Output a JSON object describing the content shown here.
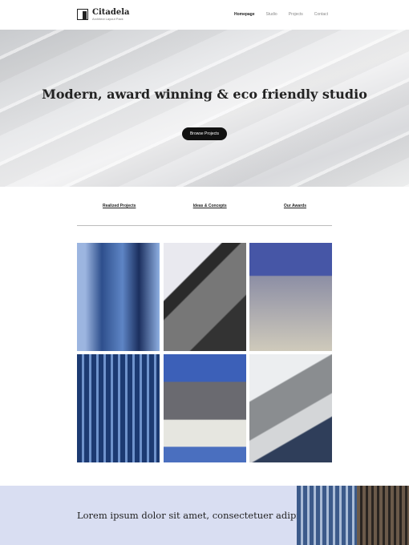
{
  "header": {
    "brand": "Citadela",
    "tagline": "Architect Layout Pack",
    "nav": [
      "Homepage",
      "Studio",
      "Projects",
      "Contact"
    ]
  },
  "hero": {
    "title": "Modern, award winning & eco friendly studio",
    "button": "Browse Projects"
  },
  "tabs": [
    "Realized Projects",
    "Ideas & Concepts",
    "Our Awards"
  ],
  "footer": {
    "text": "Lorem ipsum dolor sit amet, consectetuer adipiscing."
  }
}
